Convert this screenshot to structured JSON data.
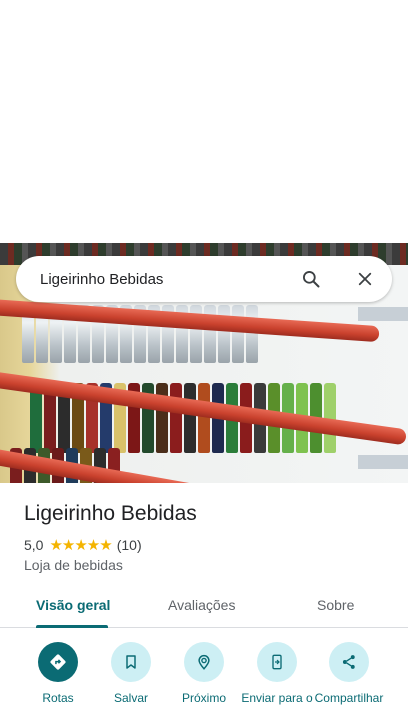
{
  "search": {
    "query": "Ligeirinho Bebidas"
  },
  "place": {
    "name": "Ligeirinho Bebidas",
    "rating": "5,0",
    "stars": "★★★★★",
    "review_count": "(10)",
    "category": "Loja de bebidas"
  },
  "tabs": [
    {
      "label": "Visão geral",
      "selected": true
    },
    {
      "label": "Avaliações",
      "selected": false
    },
    {
      "label": "Sobre",
      "selected": false
    }
  ],
  "actions": [
    {
      "label": "Rotas",
      "icon": "directions-icon"
    },
    {
      "label": "Salvar",
      "icon": "bookmark-icon"
    },
    {
      "label": "Próximo",
      "icon": "nearby-icon"
    },
    {
      "label": "Enviar para o",
      "icon": "send-to-phone-icon"
    },
    {
      "label": "Compartilhar",
      "icon": "share-icon"
    }
  ],
  "colors": {
    "accent": "#0b6b74",
    "action_bg": "#cdeff4",
    "star": "#f4b400"
  }
}
